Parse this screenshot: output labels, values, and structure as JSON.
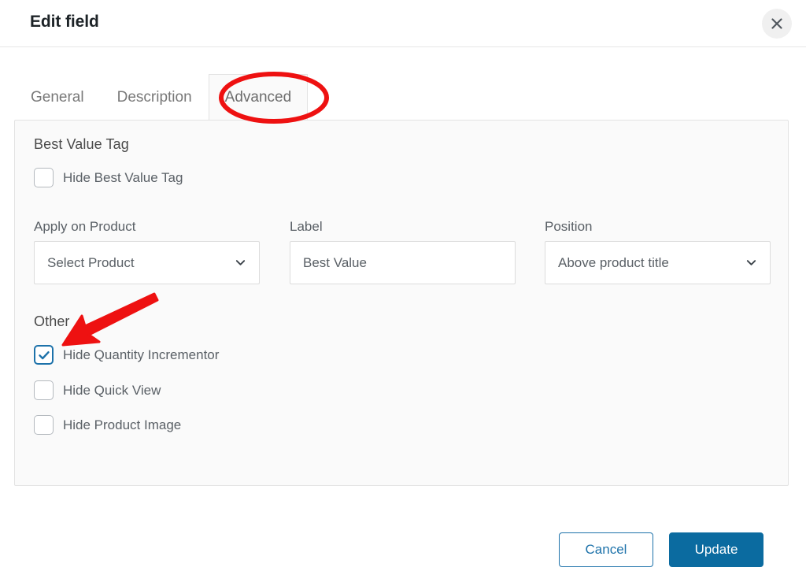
{
  "modal": {
    "title": "Edit field",
    "close_icon": "close-icon"
  },
  "tabs": [
    {
      "label": "General",
      "active": false
    },
    {
      "label": "Description",
      "active": false
    },
    {
      "label": "Advanced",
      "active": true
    }
  ],
  "sections": {
    "best_value_tag": {
      "heading": "Best Value Tag",
      "checkbox": {
        "label": "Hide Best Value Tag",
        "checked": false
      },
      "fields": {
        "apply_on_product": {
          "label": "Apply on Product",
          "value": "Select Product",
          "type": "select",
          "icon": "chevron-down-icon"
        },
        "label_field": {
          "label": "Label",
          "value": "Best Value",
          "type": "text"
        },
        "position": {
          "label": "Position",
          "value": "Above product title",
          "type": "select",
          "icon": "chevron-down-icon"
        }
      }
    },
    "other": {
      "heading": "Other",
      "checkboxes": [
        {
          "label": "Hide Quantity Incrementor",
          "checked": true
        },
        {
          "label": "Hide Quick View",
          "checked": false
        },
        {
          "label": "Hide Product Image",
          "checked": false
        }
      ]
    }
  },
  "footer": {
    "cancel_label": "Cancel",
    "update_label": "Update"
  },
  "annotations": {
    "highlight_color": "#ee1111",
    "ellipse_target": "Advanced",
    "arrow_target": "Hide Quantity Incrementor"
  },
  "colors": {
    "primary_blue": "#0b6ba0",
    "link_blue": "#1d72aa",
    "panel_bg": "#fafafa",
    "panel_border": "#e3e3e3",
    "annotation_red": "#ee1111"
  }
}
